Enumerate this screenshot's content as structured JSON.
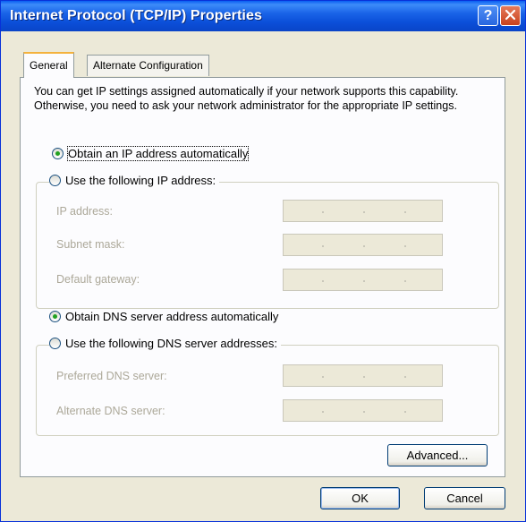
{
  "window": {
    "title": "Internet Protocol (TCP/IP) Properties",
    "help_glyph": "?",
    "close_icon": "close-icon"
  },
  "tabs": [
    {
      "label": "General",
      "active": true
    },
    {
      "label": "Alternate Configuration",
      "active": false
    }
  ],
  "intro": "You can get IP settings assigned automatically if your network supports this capability. Otherwise, you need to ask your network administrator for the appropriate IP settings.",
  "ip_section": {
    "auto_label": "Obtain an IP address automatically",
    "auto_selected": true,
    "manual_label": "Use the following IP address:",
    "manual_selected": false,
    "fields": [
      {
        "label": "IP address:",
        "value": ""
      },
      {
        "label": "Subnet mask:",
        "value": ""
      },
      {
        "label": "Default gateway:",
        "value": ""
      }
    ]
  },
  "dns_section": {
    "auto_label": "Obtain DNS server address automatically",
    "auto_selected": true,
    "manual_label": "Use the following DNS server addresses:",
    "manual_selected": false,
    "fields": [
      {
        "label": "Preferred DNS server:",
        "value": ""
      },
      {
        "label": "Alternate DNS server:",
        "value": ""
      }
    ]
  },
  "buttons": {
    "advanced": "Advanced...",
    "ok": "OK",
    "cancel": "Cancel"
  },
  "colors": {
    "titlebar": "#0a5ff2",
    "dialog_bg": "#ece9d8",
    "radio_dot": "#21a121",
    "disabled_text": "#aca899"
  }
}
